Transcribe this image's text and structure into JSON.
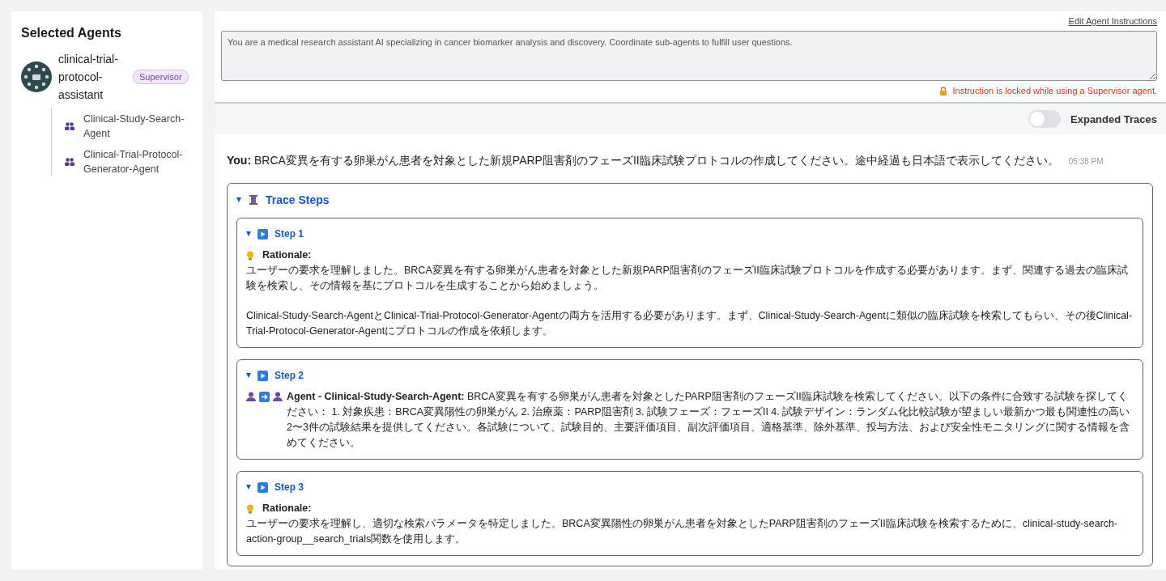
{
  "sidebar": {
    "title": "Selected Agents",
    "supervisor": {
      "name": "clinical-trial-protocol-assistant",
      "badge": "Supervisor"
    },
    "sub_agents": [
      {
        "name": "Clinical-Study-Search-Agent"
      },
      {
        "name": "Clinical-Trial-Protocol-Generator-Agent"
      }
    ]
  },
  "instructions": {
    "link": "Edit Agent Instructions",
    "value": "You are a medical research assistant AI specializing in cancer biomarker analysis and discovery. Coordinate sub-agents to fulfill user questions.",
    "locked_note": "Instruction is locked while using a Supervisor agent."
  },
  "traces_toggle": {
    "label": "Expanded Traces",
    "on": false
  },
  "message": {
    "text": "**You:** BRCA変異を有する卵巣がん患者を対象とした新規PARP阻害剤のフェーズII臨床試験プロトコルの作成してください。途中経過も日本語で表示してください。",
    "time": "05:38 PM"
  },
  "trace": {
    "title": "Trace Steps",
    "expanded": true,
    "steps": [
      {
        "title": "Step 1",
        "expanded": true,
        "kind": "rationale",
        "label": "Rationale:",
        "paragraphs": [
          "ユーザーの要求を理解しました。BRCA変異を有する卵巣がん患者を対象とした新規PARP阻害剤のフェーズII臨床試験プロトコルを作成する必要があります。まず、関連する過去の臨床試験を検索し、その情報を基にプロトコルを生成することから始めましょう。",
          "Clinical-Study-Search-AgentとClinical-Trial-Protocol-Generator-Agentの両方を活用する必要があります。まず、Clinical-Study-Search-Agentに類似の臨床試験を検索してもらい、その後Clinical-Trial-Protocol-Generator-Agentにプロトコルの作成を依頼します。"
        ]
      },
      {
        "title": "Step 2",
        "expanded": true,
        "kind": "agent",
        "paragraphs": [
          "**Agent - Clinical-Study-Search-Agent:** BRCA変異を有する卵巣がん患者を対象としたPARP阻害剤のフェーズII臨床試験を検索してください。以下の条件に合致する試験を探してください： 1. 対象疾患：BRCA変異陽性の卵巣がん 2. 治療薬：PARP阻害剤 3. 試験フェーズ：フェーズII 4. 試験デザイン：ランダム化比較試験が望ましい最新かつ最も関連性の高い2〜3件の試験結果を提供してください。各試験について、試験目的、主要評価項目、副次評価項目、適格基準、除外基準、投与方法、および安全性モニタリングに関する情報を含めてください。"
        ]
      },
      {
        "title": "Step 3",
        "expanded": true,
        "kind": "rationale",
        "label": "Rationale:",
        "paragraphs": [
          "ユーザーの要求を理解し、適切な検索パラメータを特定しました。BRCA変異陽性の卵巣がん患者を対象としたPARP阻害剤のフェーズII臨床試験を検索するために、clinical-study-search-action-group__search_trials関数を使用します。"
        ]
      }
    ]
  }
}
